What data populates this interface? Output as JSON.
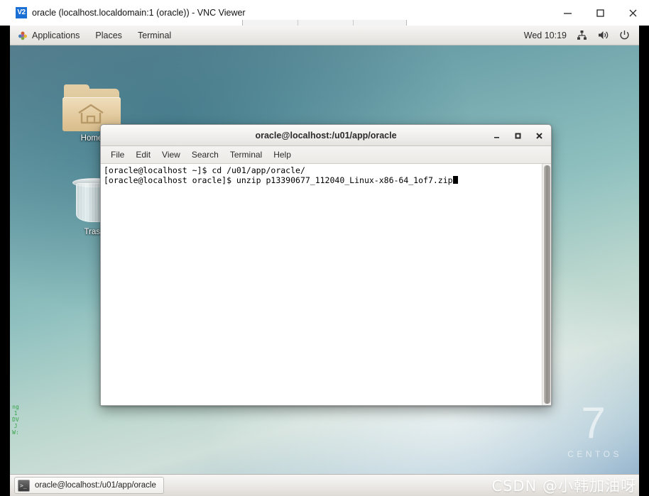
{
  "vnc_window": {
    "logo_text": "V2",
    "title": "oracle (localhost.localdomain:1 (oracle)) - VNC Viewer",
    "controls": {
      "minimize": "minimize-button",
      "maximize": "maximize-button",
      "close": "close-button"
    }
  },
  "gnome_panel": {
    "menus": [
      {
        "label": "Applications",
        "icon": "gnome-foot-icon"
      },
      {
        "label": "Places",
        "icon": null
      },
      {
        "label": "Terminal",
        "icon": null
      }
    ],
    "clock": "Wed 10:19",
    "status_icons": [
      {
        "name": "network-icon"
      },
      {
        "name": "volume-icon"
      },
      {
        "name": "power-icon"
      }
    ]
  },
  "desktop": {
    "icons": [
      {
        "name": "home-folder",
        "label": "Home",
        "icon": "home-folder-icon"
      },
      {
        "name": "trash",
        "label": "Trash",
        "icon": "trash-icon"
      }
    ],
    "branding": {
      "version": "7",
      "name": "CENTOS"
    },
    "edge_console_text": "ng 1 DVJ W:"
  },
  "terminal": {
    "title": "oracle@localhost:/u01/app/oracle",
    "menus": [
      "File",
      "Edit",
      "View",
      "Search",
      "Terminal",
      "Help"
    ],
    "controls": {
      "minimize": "minimize-button",
      "maximize": "maximize-button",
      "close": "close-button"
    },
    "lines": [
      "[oracle@localhost ~]$ cd /u01/app/oracle/",
      "[oracle@localhost oracle]$ unzip p13390677_112040_Linux-x86-64_1of7.zip"
    ]
  },
  "taskbar": {
    "tasks": [
      {
        "label": "oracle@localhost:/u01/app/oracle",
        "icon": "terminal-icon"
      }
    ],
    "watermark": "CSDN @小韩加油呀"
  }
}
